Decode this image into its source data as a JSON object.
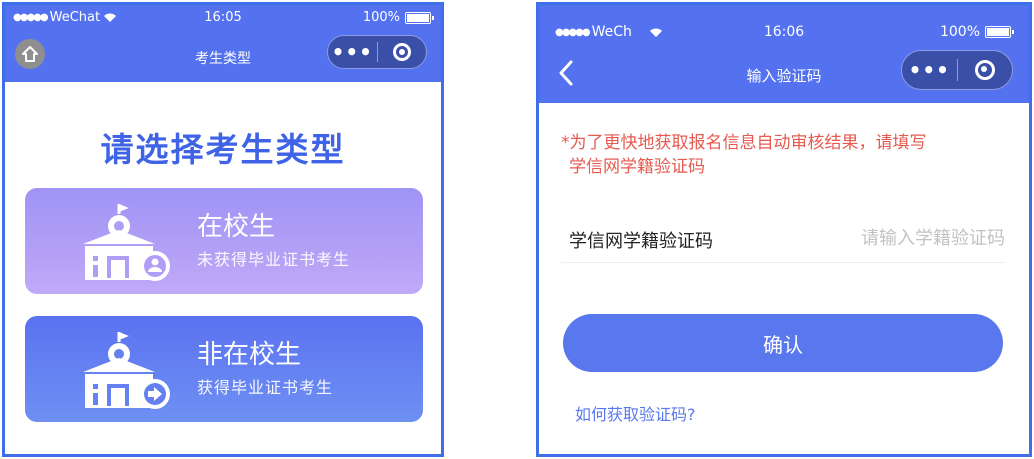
{
  "left_screen": {
    "status": {
      "carrier": "WeChat",
      "time": "16:05",
      "battery": "100%"
    },
    "nav_title": "考生类型",
    "heading": "请选择考生类型",
    "cards": [
      {
        "title": "在校生",
        "subtitle": "未获得毕业证书考生"
      },
      {
        "title": "非在校生",
        "subtitle": "获得毕业证书考生"
      }
    ]
  },
  "right_screen": {
    "status": {
      "carrier": "WeCh",
      "time": "16:06",
      "battery": "100%"
    },
    "nav_title": "输入验证码",
    "notice_line1": "*为了更快地获取报名信息自动审核结果，请填写",
    "notice_line2": "学信网学籍验证码",
    "field_label": "学信网学籍验证码",
    "field_placeholder": "请输入学籍验证码",
    "field_value": "",
    "confirm_label": "确认",
    "help_link": "如何获取验证码?"
  },
  "colors": {
    "accent": "#5472ef",
    "notice": "#e65a50",
    "heading": "#3e63e6"
  },
  "icons": [
    "home-icon",
    "back-chevron-icon",
    "more-dots-icon",
    "close-target-icon",
    "wifi-icon",
    "battery-icon",
    "school-building-icon",
    "person-badge-icon",
    "arrow-right-badge-icon"
  ]
}
